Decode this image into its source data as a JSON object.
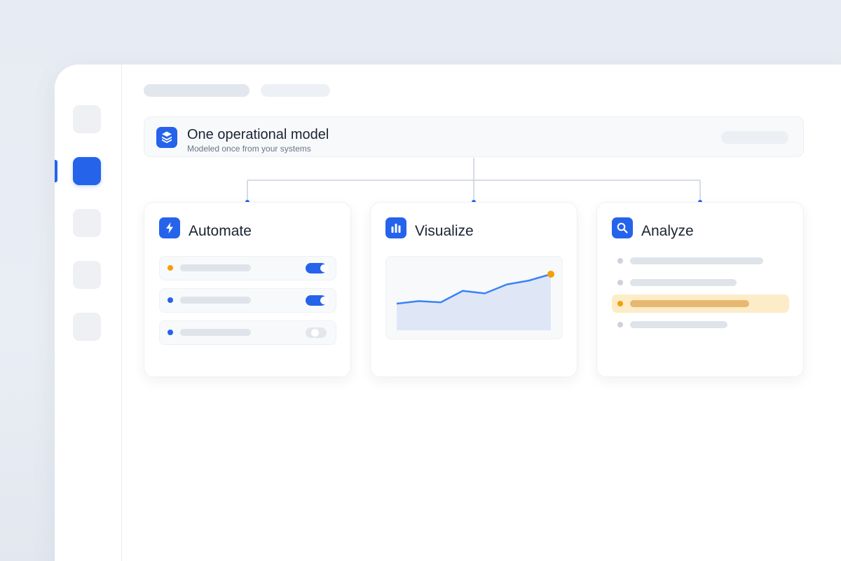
{
  "model": {
    "title": "One operational model",
    "subtitle": "Modeled once from your systems",
    "icon": "layers-icon"
  },
  "colors": {
    "accent": "#2563eb",
    "warning": "#f59e0b",
    "highlight_bg": "#fdecc8",
    "highlight_bar": "#e8b870",
    "toggle_off": "#e3e6eb",
    "skeleton": "#dfe3ea",
    "chart_line": "#3b82f6",
    "chart_fill": "#dfe7f7"
  },
  "rail": {
    "active_index": 1,
    "item_count": 5
  },
  "cards": {
    "automate": {
      "title": "Automate",
      "icon": "lightning-icon",
      "rows": [
        {
          "status": "warning",
          "enabled": true
        },
        {
          "status": "info",
          "enabled": true
        },
        {
          "status": "info",
          "enabled": false
        }
      ]
    },
    "visualize": {
      "title": "Visualize",
      "icon": "bar-chart-icon",
      "chart_data": {
        "type": "area",
        "values": [
          20,
          22,
          21,
          30,
          28,
          35,
          38,
          43
        ]
      }
    },
    "analyze": {
      "title": "Analyze",
      "icon": "search-icon",
      "items": [
        {
          "highlighted": false,
          "level": 0.85
        },
        {
          "highlighted": false,
          "level": 0.68
        },
        {
          "highlighted": true,
          "level": 0.76
        },
        {
          "highlighted": false,
          "level": 0.62
        }
      ]
    }
  }
}
